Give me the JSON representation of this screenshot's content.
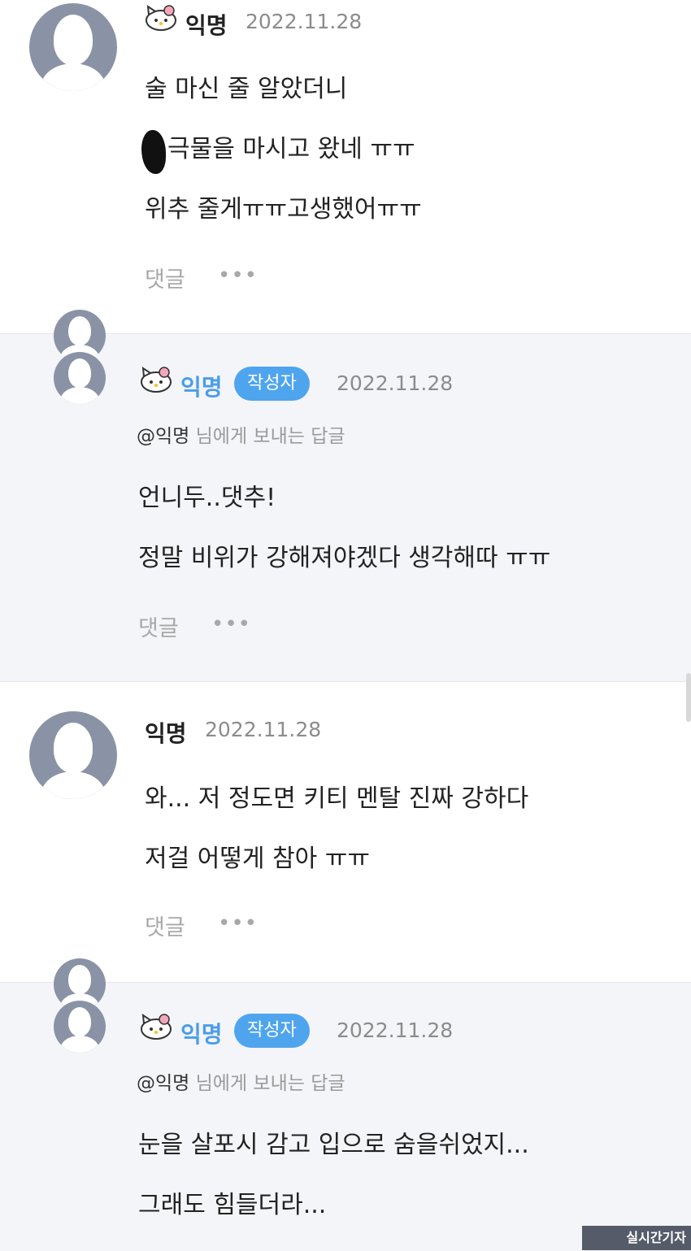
{
  "comments": [
    {
      "author": "익명",
      "date": "2022.11.28",
      "lines": [
        "술 마신 줄 알았더니",
        "극물을 마시고 왔네 ㅠㅠ",
        "위추 줄게ㅠㅠ고생했어ㅠㅠ"
      ],
      "reply_label": "댓글",
      "more_label": "•••"
    },
    {
      "author": "익명",
      "badge": "작성자",
      "date": "2022.11.28",
      "mention_name": "@익명",
      "mention_suffix": " 님에게 보내는 답글",
      "lines": [
        "언니두..댓추!",
        "정말 비위가 강해져야겠다 생각해따 ㅠㅠ"
      ],
      "reply_label": "댓글",
      "more_label": "•••"
    },
    {
      "author": "익명",
      "date": "2022.11.28",
      "lines": [
        "와... 저 정도면 키티 멘탈 진짜 강하다",
        "저걸 어떻게 참아 ㅠㅠ"
      ],
      "reply_label": "댓글",
      "more_label": "•••"
    },
    {
      "author": "익명",
      "badge": "작성자",
      "date": "2022.11.28",
      "mention_name": "@익명",
      "mention_suffix": " 님에게 보내는 답글",
      "lines": [
        "눈을 살포시 감고 입으로 숨을쉬었지...",
        "그래도 힘들더라..."
      ]
    }
  ],
  "watermark": "실시간기자",
  "colors": {
    "accent": "#4ea5ee",
    "reply_bg": "#f3f5f9",
    "avatar": "#8a93a6"
  }
}
